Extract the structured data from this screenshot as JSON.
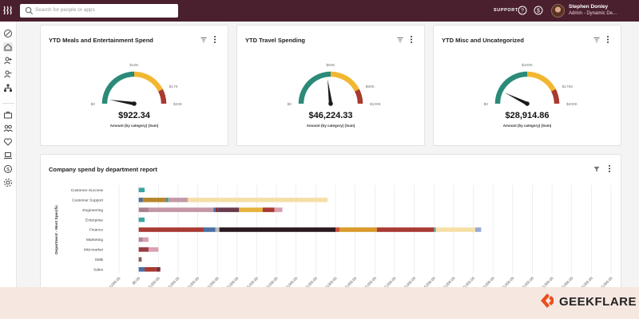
{
  "header": {
    "search_placeholder": "Search for people or apps",
    "support_label": "SUPPORT",
    "user_name": "Stephen Donley",
    "user_role": "Admin - Dynamic De..."
  },
  "cards": [
    {
      "title": "YTD Meals and Entertainment Spend",
      "value": "$922.34",
      "caption": "Amount (by category) (Sum)",
      "ticks": {
        "min": "$0",
        "top": "$10K",
        "mid": "$17K",
        "max": "$20K"
      },
      "needle_fraction": 0.05
    },
    {
      "title": "YTD Travel Spending",
      "value": "$46,224.33",
      "caption": "Amount (by category) (Sum)",
      "ticks": {
        "min": "$0",
        "top": "$50K",
        "mid": "$80K",
        "max": "$100K"
      },
      "needle_fraction": 0.46
    },
    {
      "title": "YTD Misc and Uncategorized",
      "value": "$28,914.86",
      "caption": "Amount (by category) (Sum)",
      "ticks": {
        "min": "$0",
        "top": "$100K",
        "mid": "$170K",
        "max": "$200K"
      },
      "needle_fraction": 0.145
    }
  ],
  "report": {
    "title": "Company spend by department report",
    "y_axis_label": "Department - Most Specific"
  },
  "chart_data": {
    "type": "bar",
    "orientation": "horizontal",
    "stacked": true,
    "categories": [
      "Customer Success",
      "Customer Support",
      "Engineering",
      "Enterprise",
      "Finance",
      "Marketing",
      "Mid-market",
      "SMB",
      "Sales"
    ],
    "x_ticks": [
      "-$10,000.00",
      "$0.00",
      "$10,000.00",
      "$20,000.00",
      "$30,000.00",
      "$40,000.00",
      "$50,000.00",
      "$60,000.00",
      "$70,000.00",
      "$80,000.00",
      "$90,000.00",
      "$100,000.00",
      "$110,000.00",
      "$120,000.00",
      "$130,000.00",
      "$140,000.00",
      "$150,000.00",
      "$160,000.00",
      "$170,000.00",
      "$180,000.00",
      "$190,000.00",
      "$200,000.00",
      "$210,000.00",
      "$220,000.00",
      "$230,000.00",
      "$240,000.00"
    ],
    "xlim": [
      -10000,
      240000
    ],
    "ylabel": "Department - Most Specific",
    "segments": [
      [
        {
          "value": 3000,
          "color": "#3aa6a0"
        }
      ],
      [
        {
          "value": 2000,
          "color": "#4a6fa5"
        },
        {
          "value": 12000,
          "color": "#b8862e"
        },
        {
          "value": 1000,
          "color": "#2b9a8e"
        },
        {
          "value": 10000,
          "color": "#c49aa8"
        },
        {
          "value": 71000,
          "color": "#f5dfa6"
        }
      ],
      [
        {
          "value": 5000,
          "color": "#a88090"
        },
        {
          "value": 33000,
          "color": "#c497a6"
        },
        {
          "value": 1000,
          "color": "#4a6fa5"
        },
        {
          "value": 1000,
          "color": "#7a2e3a"
        },
        {
          "value": 11000,
          "color": "#6b3a4e"
        },
        {
          "value": 12000,
          "color": "#e5b23b"
        },
        {
          "value": 6000,
          "color": "#a83a32"
        },
        {
          "value": 4000,
          "color": "#d9a0b0"
        }
      ],
      [
        {
          "value": 3000,
          "color": "#3aa6a0"
        }
      ],
      [
        {
          "value": 33000,
          "color": "#a83a32"
        },
        {
          "value": 6000,
          "color": "#4a6fa5"
        },
        {
          "value": 2000,
          "color": "#b9b9b9"
        },
        {
          "value": 59000,
          "color": "#2a1a1f"
        },
        {
          "value": 2000,
          "color": "#c94a3a"
        },
        {
          "value": 19000,
          "color": "#d99a2a"
        },
        {
          "value": 29000,
          "color": "#a83a32"
        },
        {
          "value": 1000,
          "color": "#6a9a9a"
        },
        {
          "value": 20000,
          "color": "#f5dfa6"
        },
        {
          "value": 3000,
          "color": "#9aaad8"
        }
      ],
      [
        {
          "value": 2000,
          "color": "#a8889a"
        },
        {
          "value": 3000,
          "color": "#d9a0b0"
        }
      ],
      [
        {
          "value": 5000,
          "color": "#9a3a42"
        },
        {
          "value": 5000,
          "color": "#d9a0b0"
        }
      ],
      [
        {
          "value": 1500,
          "color": "#8a5a5a"
        }
      ],
      [
        {
          "value": 3000,
          "color": "#4a6fa5"
        },
        {
          "value": 6000,
          "color": "#a83a32"
        },
        {
          "value": 2000,
          "color": "#7a2e3a"
        }
      ]
    ]
  }
}
